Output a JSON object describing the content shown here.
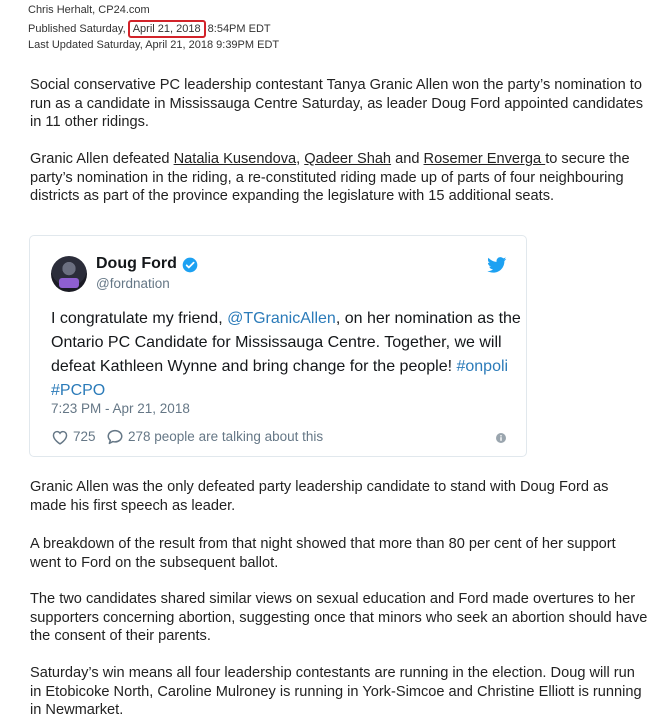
{
  "article": {
    "byline": "Chris Herhalt, CP24.com",
    "published_prefix": "Published Saturday, ",
    "published_date": "April 21, 2018",
    "published_time": " 8:54PM EDT",
    "updated": "Last Updated Saturday, April 21, 2018 9:39PM EDT",
    "p1": "Social conservative PC leadership contestant Tanya Granic Allen won the party’s nomination to run as a candidate in Mississauga Centre Saturday, as leader Doug Ford appointed candidates in 11 other ridings.",
    "p2_a": "Granic Allen defeated ",
    "p2_link1": "Natalia Kusendova",
    "p2_b": ", ",
    "p2_link2": "Qadeer Shah",
    "p2_c": " and ",
    "p2_link3": "Rosemer Enverga ",
    "p2_d": "to secure the party’s nomination in the riding, a re-constituted riding made up of parts of four neighbouring districts as part of the province expanding the legislature with 15 additional seats.",
    "p3": "Granic Allen was the only defeated party leadership candidate to stand with Doug Ford as made his first speech as leader.",
    "p4": "A breakdown of the result from that night showed that more than 80 per cent of her support went to Ford on the subsequent ballot.",
    "p5": "The two candidates shared similar views on sexual education and Ford made overtures to her supporters concerning abortion, suggesting once that minors who seek an abortion should have the consent of their parents.",
    "p6": "Saturday’s win means all four leadership contestants are running in the election. Doug will run in Etobicoke North, Caroline Mulroney is running in York-Simcoe and Christine Elliott is running in Newmarket."
  },
  "tweet": {
    "name": "Doug Ford",
    "handle": "@fordnation",
    "text_a": "I congratulate my friend, ",
    "mention": "@TGranicAllen",
    "text_b": ", on her nomination as the Ontario PC Candidate for Mississauga Centre. Together, we will defeat Kathleen Wynne and bring change for the people! ",
    "hashtags": "#onpoli #PCPO",
    "time": "7:23 PM - Apr 21, 2018",
    "likes": "725",
    "talking": "278 people are talking about this",
    "colors": {
      "link": "#2b7bb9",
      "verified": "#1da1f2",
      "highlight": "#d2232a"
    },
    "icons": [
      "verified-badge-icon",
      "twitter-bird-icon",
      "heart-icon",
      "comment-bubble-icon",
      "info-icon"
    ]
  }
}
